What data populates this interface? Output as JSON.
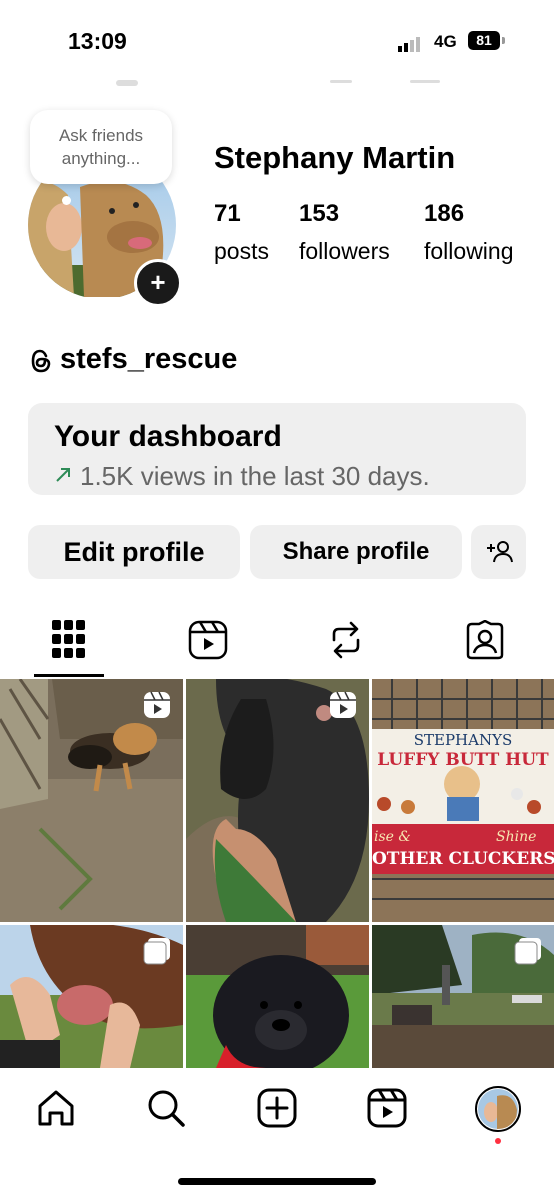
{
  "status_bar": {
    "time": "13:09",
    "network": "4G",
    "battery": "81"
  },
  "profile": {
    "note": {
      "line1": "Ask friends",
      "line2": "anything..."
    },
    "name": "Stephany Martin",
    "stats": [
      {
        "value": "71",
        "label": "posts"
      },
      {
        "value": "153",
        "label": "followers"
      },
      {
        "value": "186",
        "label": "following"
      }
    ],
    "threads_handle": "stefs_rescue"
  },
  "dashboard": {
    "title": "Your dashboard",
    "subtitle": "1.5K views in the last 30 days."
  },
  "actions": {
    "edit": "Edit profile",
    "share": "Share profile"
  },
  "tabs": [
    "grid-icon",
    "reels-icon",
    "reposts-icon",
    "tagged-icon"
  ],
  "posts": [
    {
      "desc": "german-shepherd-digging",
      "badge": "reel"
    },
    {
      "desc": "dark-dog-closeup",
      "badge": "reel"
    },
    {
      "desc": "sign",
      "badge": "",
      "sign": {
        "l1": "STEPHANYS",
        "l2": "LUFFY BUTT HUT",
        "l3a": "ise &",
        "l3b": "Shine",
        "l4": "OTHER CLUCKERS"
      }
    },
    {
      "desc": "horse-mouth",
      "badge": "carousel"
    },
    {
      "desc": "black-chow-chow",
      "badge": ""
    },
    {
      "desc": "garden-firepit",
      "badge": "carousel"
    }
  ],
  "nav": [
    "home-icon",
    "search-icon",
    "create-icon",
    "reels-icon",
    "profile-avatar"
  ],
  "colors": {
    "accent_green": "#2e8b57",
    "badge_red": "#ff3040",
    "button_bg": "#efefef"
  }
}
